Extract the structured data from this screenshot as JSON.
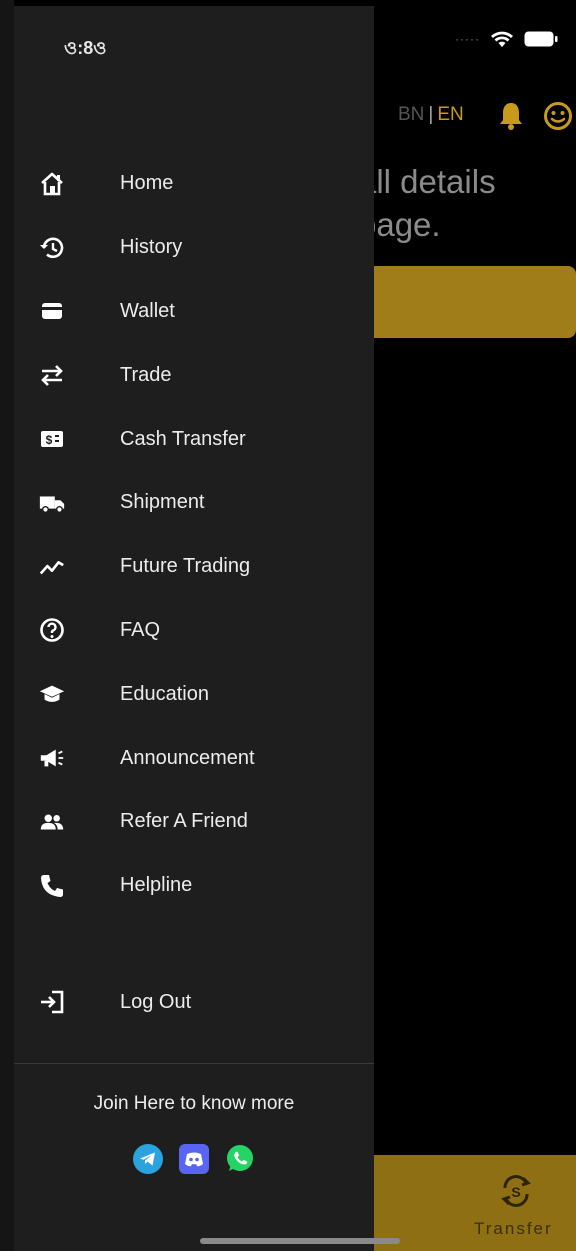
{
  "status_bar": {
    "time": "ও:8ও"
  },
  "header": {
    "lang_bn": "BN",
    "lang_sep": "|",
    "lang_en": "EN"
  },
  "background": {
    "text_line1": "all details",
    "text_line2": "page.",
    "bottom_nav_label": "Transfer"
  },
  "drawer": {
    "menu": [
      {
        "label": "Home",
        "icon": "home-icon"
      },
      {
        "label": "History",
        "icon": "history-icon"
      },
      {
        "label": "Wallet",
        "icon": "wallet-icon"
      },
      {
        "label": "Trade",
        "icon": "trade-icon"
      },
      {
        "label": "Cash Transfer",
        "icon": "cash-transfer-icon"
      },
      {
        "label": "Shipment",
        "icon": "truck-icon"
      },
      {
        "label": "Future Trading",
        "icon": "trending-icon"
      },
      {
        "label": "FAQ",
        "icon": "help-icon"
      },
      {
        "label": "Education",
        "icon": "graduation-cap-icon"
      },
      {
        "label": "Announcement",
        "icon": "megaphone-icon"
      },
      {
        "label": "Refer A Friend",
        "icon": "people-icon"
      },
      {
        "label": "Helpline",
        "icon": "phone-icon"
      }
    ],
    "logout_label": "Log Out",
    "join_text": "Join Here to know more",
    "socials": [
      "telegram-icon",
      "discord-icon",
      "whatsapp-icon"
    ]
  },
  "colors": {
    "drawer_bg": "#1e1e1e",
    "accent_gold": "#c79a1c",
    "text": "#ececec"
  }
}
